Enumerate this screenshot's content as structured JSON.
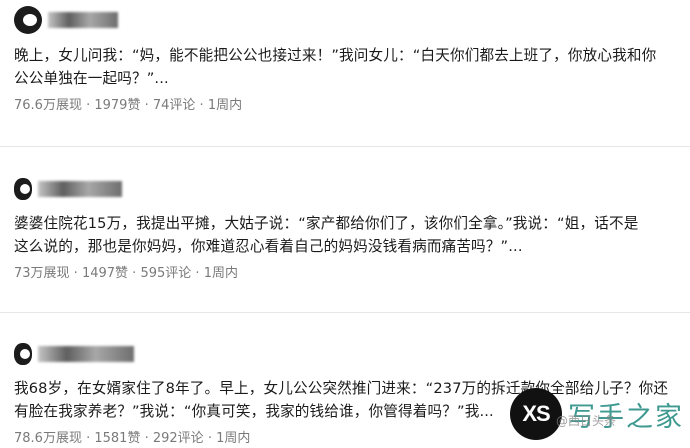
{
  "posts": [
    {
      "content_line1": "晚上，女儿问我：“妈，能不能把公公也接过来！”我问女儿：“白天你们都去上班了，你放心我和你",
      "content_line2": "公公单独在一起吗？”...",
      "meta": {
        "views": "76.6万展现",
        "likes": "1979赞",
        "comments": "74评论",
        "time": "1周内"
      }
    },
    {
      "content_line1": "婆婆住院花15万，我提出平摊，大姑子说：“家产都给你们了，该你们全拿。”我说：“姐，话不是",
      "content_line2": "这么说的，那也是你妈妈，你难道忍心看着自己的妈妈没钱看病而痛苦吗？”...",
      "meta": {
        "views": "73万展现",
        "likes": "1497赞",
        "comments": "595评论",
        "time": "1周内"
      }
    },
    {
      "content_line1": "我68岁，在女婿家住了8年了。早上，女儿公公突然推门进来：“237万的拆迁款你全部给儿子？你还",
      "content_line2": "有脸在我家养老？”我说：“你真可笑，我家的钱给谁，你管得着吗？”我...",
      "meta": {
        "views": "78.6万展现",
        "likes": "1581赞",
        "comments": "292评论",
        "time": "1周内"
      }
    }
  ],
  "separator": " · ",
  "watermark": {
    "logo": "XS",
    "text": "写手之家",
    "sub": "@西日头条"
  }
}
